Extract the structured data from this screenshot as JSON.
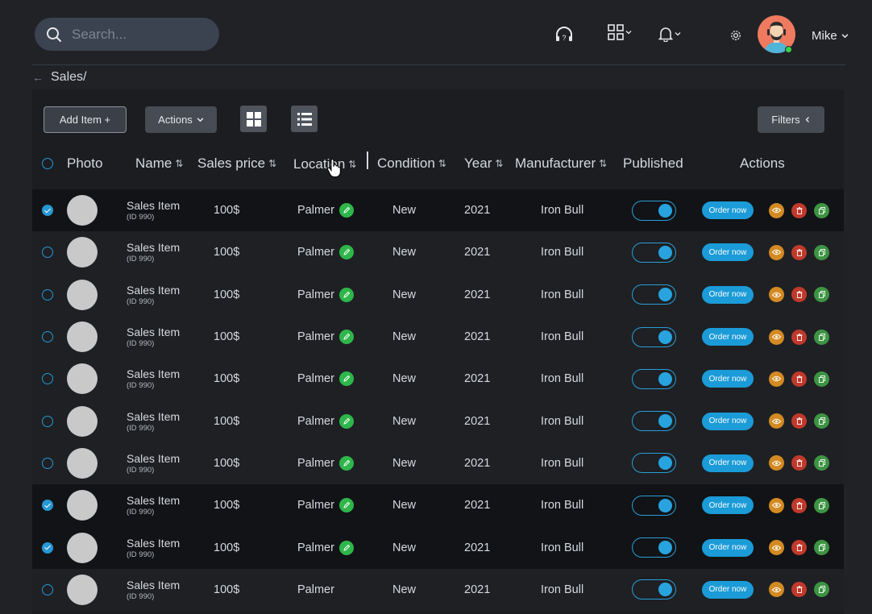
{
  "search": {
    "placeholder": "Search..."
  },
  "user": {
    "name": "Mike"
  },
  "breadcrumb": {
    "path": "Sales/"
  },
  "toolbar": {
    "add_label": "Add Item +",
    "actions_label": "Actions",
    "filters_label": "Filters"
  },
  "columns": {
    "photo": "Photo",
    "name": "Name",
    "price": "Sales price",
    "location": "Location",
    "condition": "Condition",
    "year": "Year",
    "manufacturer": "Manufacturer",
    "published": "Published",
    "actions": "Actions",
    "sort_glyph": "⇅"
  },
  "rows": [
    {
      "selected": true,
      "name": "Sales Item",
      "id": "(ID 990)",
      "price": "100$",
      "location": "Palmer",
      "editable": true,
      "condition": "New",
      "year": "2021",
      "manufacturer": "Iron Bull",
      "published": true,
      "order_label": "Order now"
    },
    {
      "selected": false,
      "name": "Sales Item",
      "id": "(ID 990)",
      "price": "100$",
      "location": "Palmer",
      "editable": true,
      "condition": "New",
      "year": "2021",
      "manufacturer": "Iron Bull",
      "published": true,
      "order_label": "Order now"
    },
    {
      "selected": false,
      "name": "Sales Item",
      "id": "(ID 990)",
      "price": "100$",
      "location": "Palmer",
      "editable": true,
      "condition": "New",
      "year": "2021",
      "manufacturer": "Iron Bull",
      "published": true,
      "order_label": "Order now"
    },
    {
      "selected": false,
      "name": "Sales Item",
      "id": "(ID 990)",
      "price": "100$",
      "location": "Palmer",
      "editable": true,
      "condition": "New",
      "year": "2021",
      "manufacturer": "Iron Bull",
      "published": true,
      "order_label": "Order now"
    },
    {
      "selected": false,
      "name": "Sales Item",
      "id": "(ID 990)",
      "price": "100$",
      "location": "Palmer",
      "editable": true,
      "condition": "New",
      "year": "2021",
      "manufacturer": "Iron Bull",
      "published": true,
      "order_label": "Order now"
    },
    {
      "selected": false,
      "name": "Sales Item",
      "id": "(ID 990)",
      "price": "100$",
      "location": "Palmer",
      "editable": true,
      "condition": "New",
      "year": "2021",
      "manufacturer": "Iron Bull",
      "published": true,
      "order_label": "Order now"
    },
    {
      "selected": false,
      "name": "Sales Item",
      "id": "(ID 990)",
      "price": "100$",
      "location": "Palmer",
      "editable": true,
      "condition": "New",
      "year": "2021",
      "manufacturer": "Iron Bull",
      "published": true,
      "order_label": "Order now"
    },
    {
      "selected": true,
      "name": "Sales Item",
      "id": "(ID 990)",
      "price": "100$",
      "location": "Palmer",
      "editable": true,
      "condition": "New",
      "year": "2021",
      "manufacturer": "Iron Bull",
      "published": true,
      "order_label": "Order now"
    },
    {
      "selected": true,
      "name": "Sales Item",
      "id": "(ID 990)",
      "price": "100$",
      "location": "Palmer",
      "editable": true,
      "condition": "New",
      "year": "2021",
      "manufacturer": "Iron Bull",
      "published": true,
      "order_label": "Order now"
    },
    {
      "selected": false,
      "name": "Sales Item",
      "id": "(ID 990)",
      "price": "100$",
      "location": "Palmer",
      "editable": false,
      "condition": "New",
      "year": "2021",
      "manufacturer": "Iron Bull",
      "published": true,
      "order_label": "Order now"
    }
  ],
  "colors": {
    "accent": "#1b9bd7",
    "edit": "#2eb64a",
    "view": "#d38a22",
    "delete": "#c0392b",
    "copy": "#3d9443",
    "avatar_bg": "#ef7a5f"
  },
  "icons": [
    "search-icon",
    "headset-icon",
    "apps-grid-icon",
    "bell-icon",
    "gear-icon",
    "back-arrow-icon",
    "grid-view-icon",
    "list-view-icon",
    "pencil-icon",
    "eye-icon",
    "trash-icon",
    "copy-icon"
  ]
}
